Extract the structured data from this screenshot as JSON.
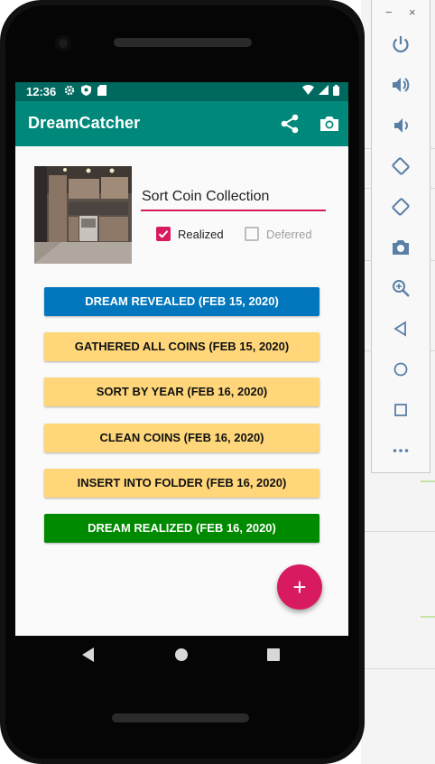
{
  "status_bar": {
    "time": "12:36"
  },
  "app": {
    "title": "DreamCatcher",
    "share_icon": "share-icon",
    "camera_icon": "camera-icon"
  },
  "dream": {
    "title_value": "Sort Coin Collection",
    "realized_label": "Realized",
    "realized_checked": true,
    "deferred_label": "Deferred",
    "deferred_checked": false
  },
  "entries": [
    {
      "label": "DREAM REVEALED (FEB 15, 2020)",
      "bg": "#0277bd",
      "fg": "#ffffff"
    },
    {
      "label": "GATHERED ALL COINS (FEB 15, 2020)",
      "bg": "#ffd77a",
      "fg": "#111111"
    },
    {
      "label": "SORT BY YEAR (FEB 16, 2020)",
      "bg": "#ffd77a",
      "fg": "#111111"
    },
    {
      "label": "CLEAN COINS (FEB 16, 2020)",
      "bg": "#ffd77a",
      "fg": "#111111"
    },
    {
      "label": "INSERT INTO FOLDER (FEB 16, 2020)",
      "bg": "#ffd77a",
      "fg": "#111111"
    },
    {
      "label": "DREAM REALIZED (FEB 16, 2020)",
      "bg": "#008a00",
      "fg": "#ffffff"
    }
  ],
  "fab": {
    "label": "+"
  },
  "emulator_panel": {
    "minimize_label": "−",
    "close_label": "×",
    "tools": [
      "power-icon",
      "volume-up-icon",
      "volume-down-icon",
      "rotate-left-icon",
      "rotate-right-icon",
      "screenshot-icon",
      "zoom-icon",
      "back-icon",
      "home-icon",
      "overview-icon",
      "more-icon"
    ]
  },
  "colors": {
    "status_bar": "#00695f",
    "app_bar": "#00897b",
    "accent": "#d81b60"
  }
}
